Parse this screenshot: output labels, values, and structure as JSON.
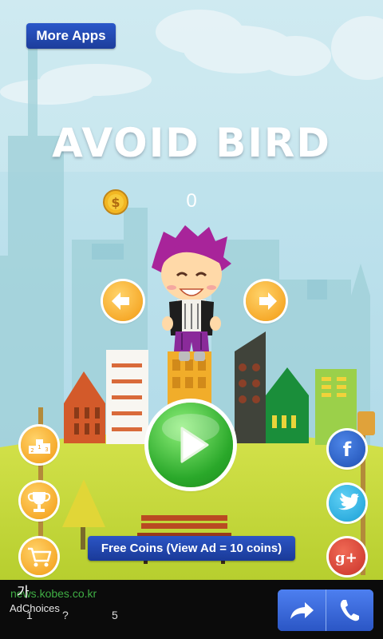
{
  "header": {
    "more_apps_label": "More Apps"
  },
  "game": {
    "title": "AVOID BIRD",
    "coin_count": "0"
  },
  "buttons": {
    "prev_character": "arrow-left-icon",
    "next_character": "arrow-right-icon",
    "play": "play-icon",
    "leaderboard": "podium-icon",
    "achievements": "trophy-icon",
    "shop": "cart-icon",
    "facebook": "facebook-icon",
    "twitter": "twitter-icon",
    "google_plus": "google-plus-icon"
  },
  "free_coins_label": "Free Coins (View Ad = 10 coins)",
  "ad": {
    "url": "news.kobes.co.kr",
    "glyph": "가",
    "adchoices": "AdChoices",
    "nums": [
      "1",
      "?",
      "5"
    ],
    "share_icon": "share-arrow-icon",
    "call_icon": "phone-icon"
  },
  "colors": {
    "sky": "#b9e0ec",
    "ground": "#c4d93a",
    "button_blue": "#2143a8",
    "orange_button": "#f7a11a",
    "play_green": "#3fc23a"
  }
}
